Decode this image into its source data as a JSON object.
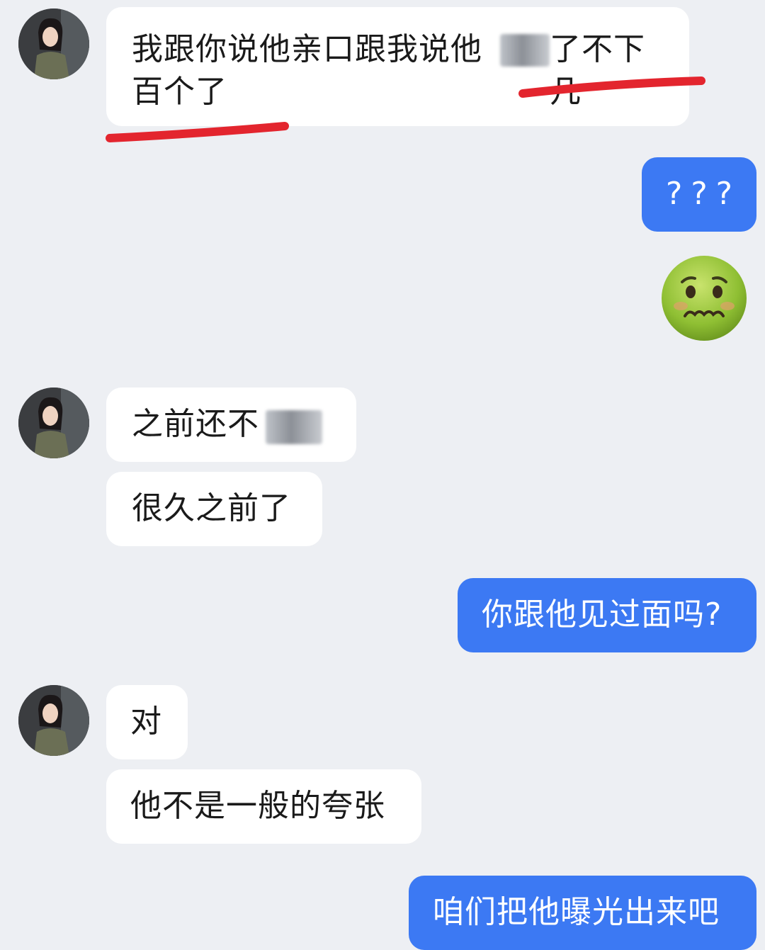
{
  "messages": [
    {
      "from": "other",
      "text": "我跟你说他亲口跟我说他",
      "text_tail": "了不下几",
      "text_line2": "百个了"
    },
    {
      "from": "me",
      "text": "???"
    },
    {
      "from": "me",
      "emoji": "nauseated-face-emoji"
    },
    {
      "from": "other",
      "text": "之前还不"
    },
    {
      "from": "other",
      "text": "很久之前了"
    },
    {
      "from": "me",
      "text": "你跟他见过面吗?"
    },
    {
      "from": "other",
      "text": "对"
    },
    {
      "from": "other",
      "text": "他不是一般的夸张"
    },
    {
      "from": "me",
      "text": "咱们把他曝光出来吧"
    }
  ],
  "colors": {
    "background": "#edeff3",
    "incoming_bubble": "#ffffff",
    "outgoing_bubble": "#3c79f3",
    "underline": "#e3252e"
  }
}
